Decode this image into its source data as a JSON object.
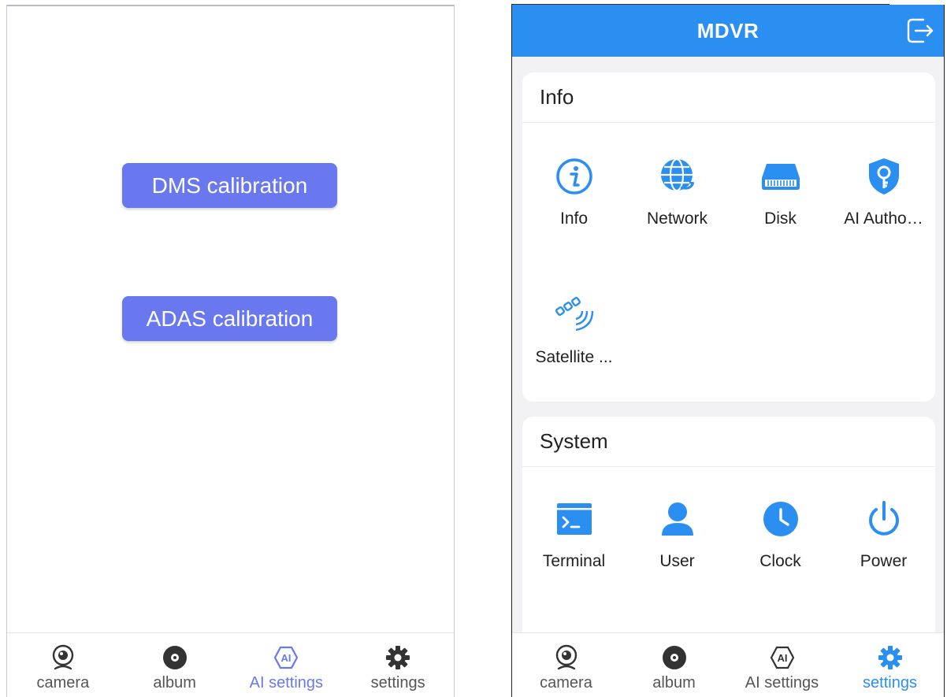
{
  "left_screen": {
    "buttons": {
      "dms": "DMS calibration",
      "adas": "ADAS calibration"
    },
    "tabs": [
      {
        "label": "camera",
        "icon": "camera-icon"
      },
      {
        "label": "album",
        "icon": "album-icon"
      },
      {
        "label": "AI settings",
        "icon": "ai-icon",
        "active": true
      },
      {
        "label": "settings",
        "icon": "gear-icon"
      }
    ],
    "accent": "#6a78ef"
  },
  "right_screen": {
    "title": "MDVR",
    "accent": "#2a8ff0",
    "info_section": {
      "heading": "Info",
      "items": [
        {
          "label": "Info",
          "icon": "info-icon"
        },
        {
          "label": "Network",
          "icon": "network-icon"
        },
        {
          "label": "Disk",
          "icon": "disk-icon"
        },
        {
          "label": "AI Autho…",
          "icon": "shield-key-icon"
        },
        {
          "label": "Satellite ...",
          "icon": "satellite-icon"
        }
      ]
    },
    "system_section": {
      "heading": "System",
      "items": [
        {
          "label": "Terminal",
          "icon": "terminal-icon"
        },
        {
          "label": "User",
          "icon": "user-icon"
        },
        {
          "label": "Clock",
          "icon": "clock-icon"
        },
        {
          "label": "Power",
          "icon": "power-icon"
        }
      ]
    },
    "tabs": [
      {
        "label": "camera",
        "icon": "camera-icon"
      },
      {
        "label": "album",
        "icon": "album-icon"
      },
      {
        "label": "AI settings",
        "icon": "ai-icon"
      },
      {
        "label": "settings",
        "icon": "gear-icon",
        "active": true
      }
    ]
  }
}
